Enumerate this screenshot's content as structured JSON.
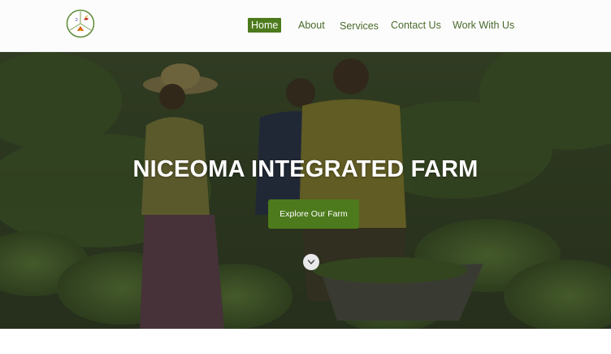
{
  "brand": {
    "logo_icon": "farm-logo-icon"
  },
  "nav": {
    "items": [
      {
        "label": "Home",
        "active": true
      },
      {
        "label": "About",
        "active": false
      },
      {
        "label": "Services",
        "active": false
      },
      {
        "label": "Contact Us",
        "active": false
      },
      {
        "label": "Work With Us",
        "active": false
      }
    ]
  },
  "hero": {
    "title": "NICEOMA INTEGRATED FARM",
    "cta_label": "Explore Our Farm",
    "scroll_icon": "chevron-down-icon"
  },
  "colors": {
    "accent": "#4d7a1c",
    "nav_text": "#4a6a2c",
    "hero_overlay": "#26301c"
  }
}
